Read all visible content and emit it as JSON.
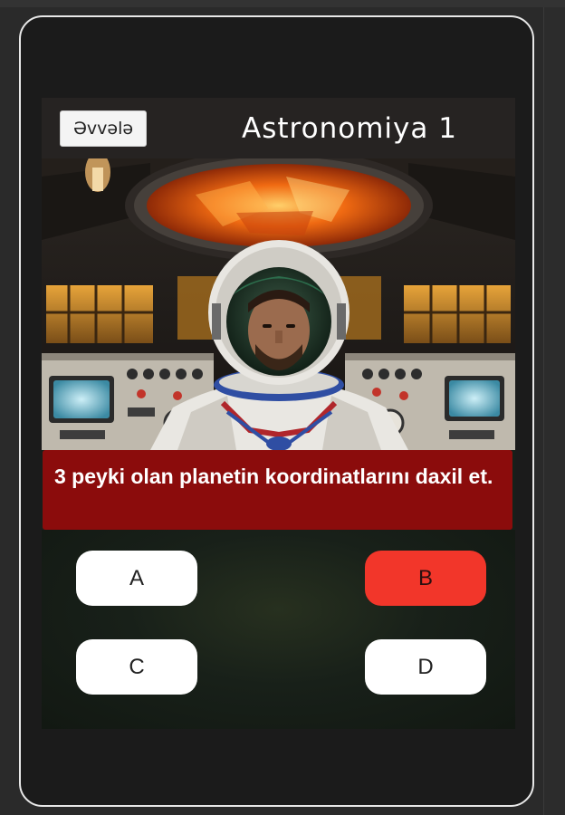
{
  "header": {
    "back_label": "Əvvələ",
    "title": "Astronomiya 1"
  },
  "question": {
    "text": "3 peyki olan planetin koordinatlarını daxil et."
  },
  "answers": [
    {
      "label": "A",
      "selected": false
    },
    {
      "label": "B",
      "selected": true
    },
    {
      "label": "C",
      "selected": false
    },
    {
      "label": "D",
      "selected": false
    }
  ],
  "colors": {
    "question_bg": "#8b0c0c",
    "selected_answer": "#f2362a",
    "answer_bg": "#ffffff"
  },
  "scene": {
    "description_icon": "astronaut-cockpit-image"
  }
}
